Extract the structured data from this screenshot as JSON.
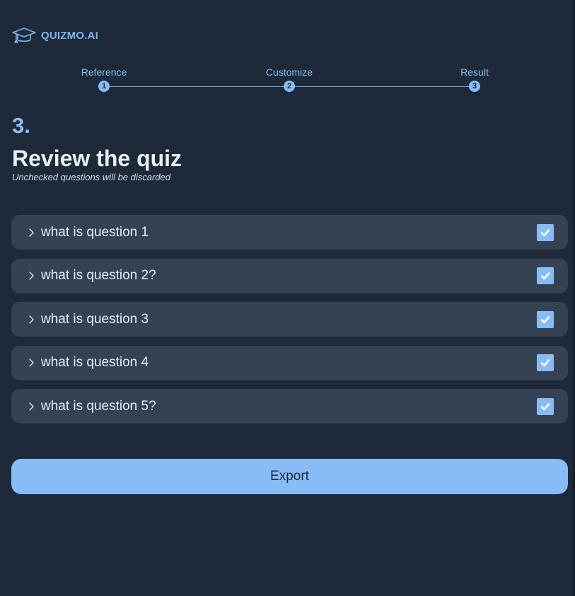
{
  "brand": {
    "name": "QUIZMO.AI",
    "icon": "graduation-cap-icon"
  },
  "stepper": {
    "steps": [
      {
        "label": "Reference",
        "number": "1"
      },
      {
        "label": "Customize",
        "number": "2"
      },
      {
        "label": "Result",
        "number": "3"
      }
    ],
    "current_step": 3
  },
  "page": {
    "step_number": "3.",
    "title": "Review the quiz",
    "subtitle": "Unchecked questions will be discarded"
  },
  "questions": [
    {
      "text": "what is question 1",
      "checked": true
    },
    {
      "text": "what is question 2?",
      "checked": true
    },
    {
      "text": "what is question 3",
      "checked": true
    },
    {
      "text": "what is question 4",
      "checked": true
    },
    {
      "text": "what is question 5?",
      "checked": true
    }
  ],
  "actions": {
    "export_label": "Export"
  },
  "colors": {
    "background": "#1e2939",
    "card": "#364253",
    "accent": "#86bdf6",
    "text": "#e8eef6"
  }
}
